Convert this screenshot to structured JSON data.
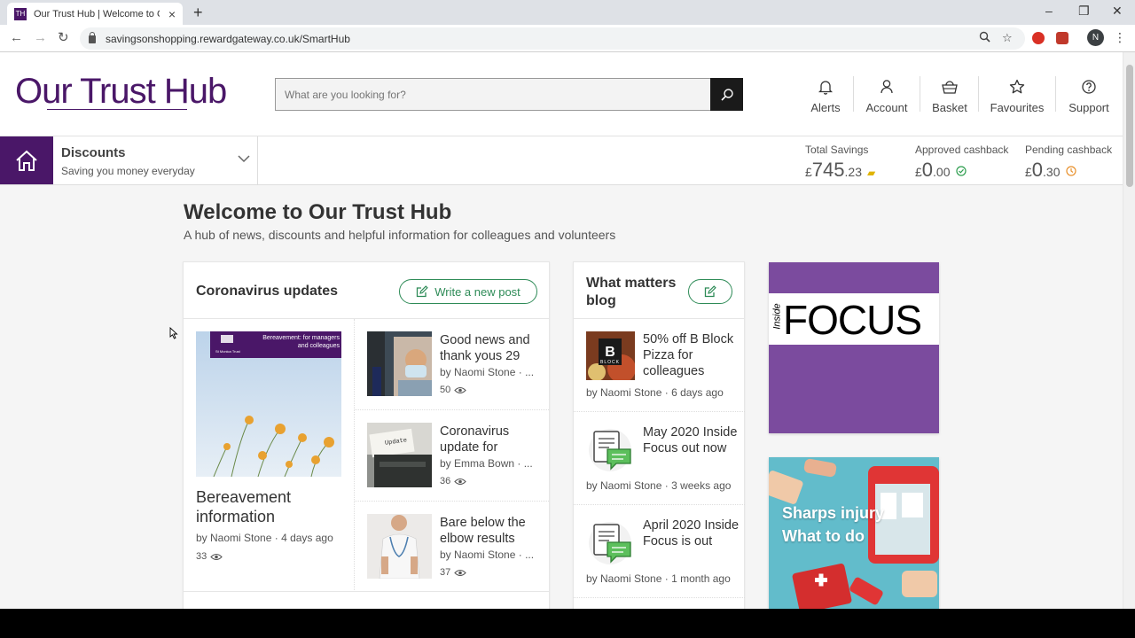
{
  "browser": {
    "tab_title": "Our Trust Hub | Welcome to Our",
    "tab_favicon_text": "TH",
    "url": "savingsonshopping.rewardgateway.co.uk/SmartHub",
    "profile_initial": "N"
  },
  "header": {
    "logo": "Our Trust Hub",
    "search_placeholder": "What are you looking for?",
    "nav": [
      {
        "label": "Alerts",
        "icon": "bell-icon"
      },
      {
        "label": "Account",
        "icon": "user-icon"
      },
      {
        "label": "Basket",
        "icon": "basket-icon"
      },
      {
        "label": "Favourites",
        "icon": "star-icon"
      },
      {
        "label": "Support",
        "icon": "help-icon"
      }
    ],
    "brand_color": "#4a1768"
  },
  "subbar": {
    "section_title": "Discounts",
    "section_sub": "Saving you money everyday",
    "total_savings": {
      "label": "Total Savings",
      "currency": "£",
      "major": "745",
      "minor": ".23"
    },
    "approved": {
      "label": "Approved cashback",
      "currency": "£",
      "major": "0",
      "minor": ".00"
    },
    "pending": {
      "label": "Pending cashback",
      "currency": "£",
      "major": "0",
      "minor": ".30"
    }
  },
  "welcome": {
    "title": "Welcome to Our Trust Hub",
    "subtitle": "A hub of news, discounts and helpful information for colleagues and volunteers"
  },
  "coronavirus": {
    "title": "Coronavirus updates",
    "write_label": "Write a new post",
    "feature": {
      "img_caption": "Bereavement: for managers and colleagues",
      "img_brand": "St Monica Trust",
      "title": "Bereavement information",
      "author": "by Naomi Stone",
      "time": "4 days ago",
      "views": "33"
    },
    "posts": [
      {
        "title": "Good news and thank yous 29",
        "author": "by Naomi Stone",
        "ellipsis": "...",
        "views": "50"
      },
      {
        "title": "Coronavirus update for",
        "author": "by Emma Bown",
        "ellipsis": "...",
        "views": "36",
        "thumb_text": "Update"
      },
      {
        "title": "Bare below the elbow results",
        "author": "by Naomi Stone",
        "ellipsis": "...",
        "views": "37"
      }
    ]
  },
  "blog": {
    "title": "What matters blog",
    "items": [
      {
        "title": "50% off B Block Pizza for colleagues",
        "author": "by Naomi Stone",
        "time": "6 days ago",
        "thumb_text": "BLOCK"
      },
      {
        "title": "May 2020 Inside Focus out now",
        "author": "by Naomi Stone",
        "time": "3 weeks ago"
      },
      {
        "title": "April 2020 Inside Focus is out",
        "author": "by Naomi Stone",
        "time": "1 month ago"
      }
    ]
  },
  "promos": {
    "focus_small": "Inside",
    "focus_big": "FOCUS",
    "sharps_line1": "Sharps injury",
    "sharps_line2": "What to do",
    "focus_color": "#7b4b9e"
  }
}
